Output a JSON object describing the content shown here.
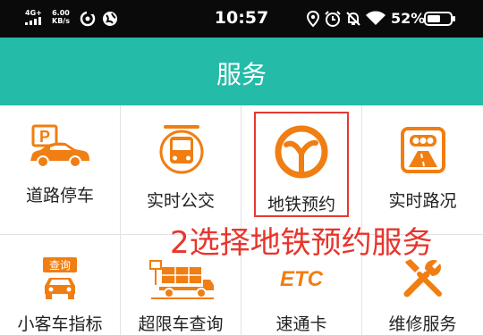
{
  "status_bar": {
    "network": "4G+",
    "speed_value": "6.00",
    "speed_unit": "KB/s",
    "time": "10:57",
    "battery": "52%"
  },
  "header": {
    "title": "服务"
  },
  "services": [
    {
      "label": "道路停车",
      "icon": "parking-car-icon"
    },
    {
      "label": "实时公交",
      "icon": "bus-icon"
    },
    {
      "label": "地铁预约",
      "icon": "metro-logo-icon"
    },
    {
      "label": "实时路况",
      "icon": "traffic-light-road-icon"
    },
    {
      "label": "小客车指标",
      "icon": "query-car-icon",
      "badge": "查询"
    },
    {
      "label": "超限车查询",
      "icon": "overweight-truck-icon"
    },
    {
      "label": "速通卡",
      "icon": "etc-icon",
      "badge": "ETC"
    },
    {
      "label": "维修服务",
      "icon": "tools-icon"
    }
  ],
  "annotation": {
    "text": "2选择地铁预约服务"
  },
  "colors": {
    "accent_teal": "#24bba8",
    "icon_orange": "#f07e12",
    "highlight_red": "#e53935"
  }
}
